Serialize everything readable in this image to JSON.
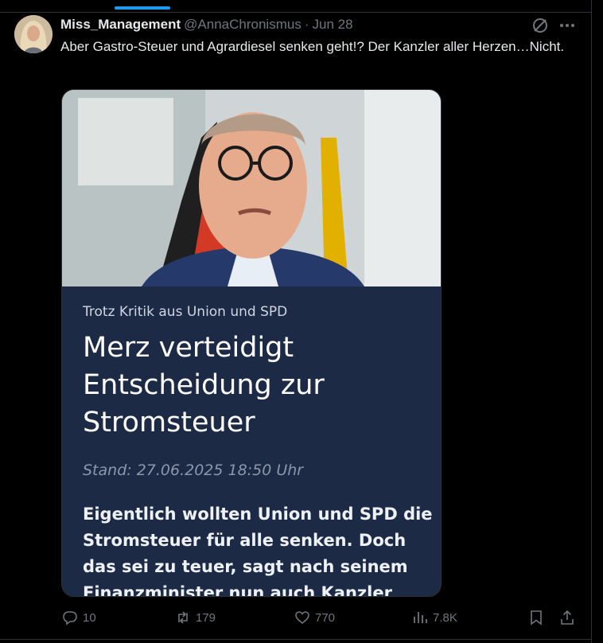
{
  "tweet": {
    "author_name": "Miss_Management",
    "handle": "@AnnaChronismus",
    "separator": "·",
    "date": "Jun 28",
    "text": "Aber Gastro-Steuer  und Agrardiesel senken geht!? Der Kanzler aller Herzen…Nicht."
  },
  "card": {
    "kicker": "Trotz Kritik aus Union und SPD",
    "headline": "Merz verteidigt Entscheidung zur Stromsteuer",
    "stand": "Stand: 27.06.2025 18:50 Uhr",
    "lead": "Eigentlich wollten Union und SPD die Stromsteuer für alle senken. Doch das sei zu teuer, sagt nach seinem Finanzminister nun auch Kanzler"
  },
  "actions": {
    "replies": "10",
    "reposts": "179",
    "likes": "770",
    "views": "7.8K"
  },
  "icons": {
    "grok": "grok-icon",
    "more": "more-icon",
    "reply": "reply-icon",
    "repost": "repost-icon",
    "like": "like-icon",
    "views": "views-icon",
    "bookmark": "bookmark-icon",
    "share": "share-icon"
  },
  "colors": {
    "accent": "#1d9bf0",
    "text": "#e7e9ea",
    "muted": "#71767b",
    "card_panel": "#1c2a45"
  }
}
